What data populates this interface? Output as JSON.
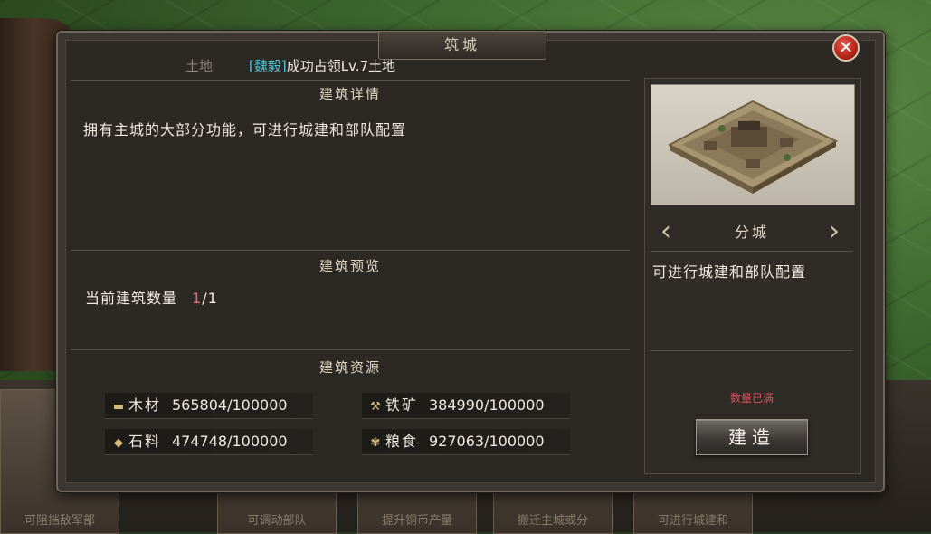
{
  "background": {
    "cards": [
      "可阻挡敌军部",
      "可调动部队",
      "提升铜币产量",
      "搬迁主城或分",
      "可进行城建和"
    ]
  },
  "dialog": {
    "title": "筑城",
    "close_glyph": "✕",
    "notice": {
      "faded_text": "土地",
      "faction": "[魏毅]",
      "message": "成功占领Lv.7土地"
    }
  },
  "details": {
    "header": "建筑详情",
    "description": "拥有主城的大部分功能，可进行城建和部队配置"
  },
  "preview": {
    "header": "建筑预览",
    "count_label": "当前建筑数量",
    "count_current": "1",
    "count_max": "/1"
  },
  "resources": {
    "header": "建筑资源",
    "items": [
      {
        "icon": "wood-icon",
        "glyph": "▬",
        "name": "木材",
        "value": "565804/100000"
      },
      {
        "icon": "iron-icon",
        "glyph": "⚒",
        "name": "铁矿",
        "value": "384990/100000"
      },
      {
        "icon": "stone-icon",
        "glyph": "◆",
        "name": "石料",
        "value": "474748/100000"
      },
      {
        "icon": "grain-icon",
        "glyph": "✾",
        "name": "粮食",
        "value": "927063/100000"
      }
    ]
  },
  "city": {
    "name": "分城",
    "description": "可进行城建和部队配置",
    "status": "数量已满",
    "build_label": "建造",
    "prev_glyph": "‹",
    "next_glyph": "›"
  },
  "colors": {
    "faction": "#4fc6d6",
    "count_current": "#e3717a",
    "status": "#d8505a",
    "close": "#b42318"
  }
}
